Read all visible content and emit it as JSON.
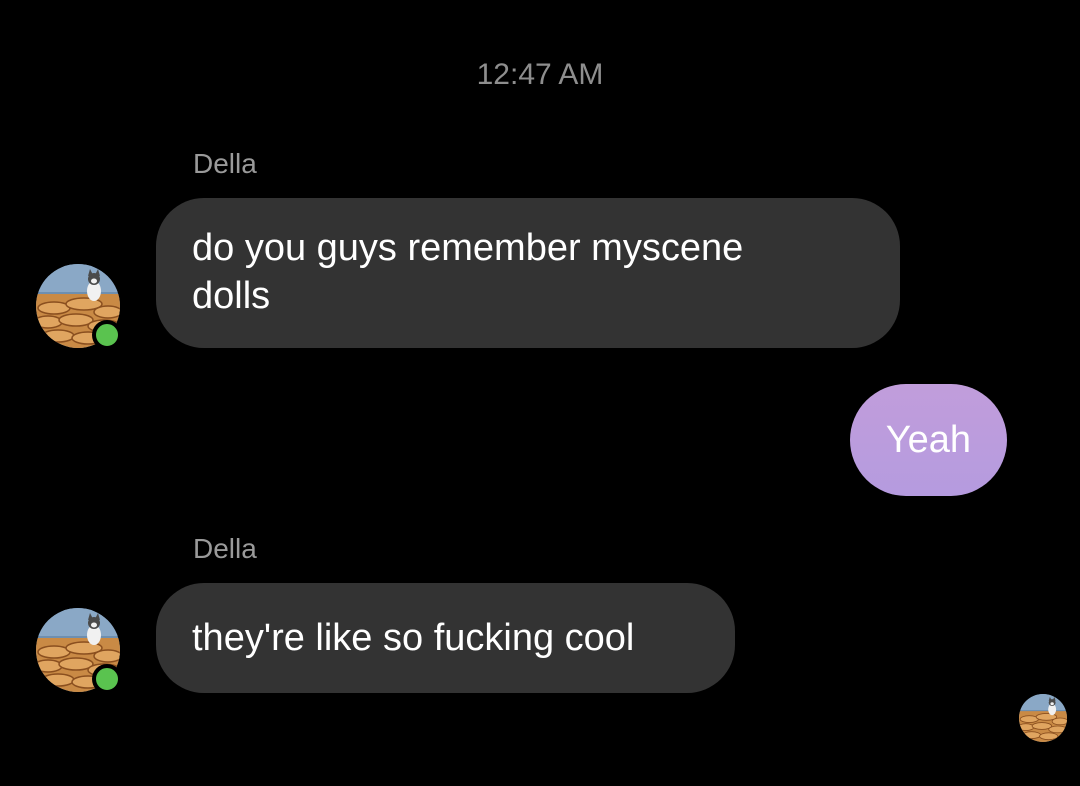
{
  "chat": {
    "timestamp": "12:47 AM",
    "messages": [
      {
        "sender": "Della",
        "direction": "incoming",
        "lines": [
          "do you guys remember myscene",
          "dolls"
        ]
      },
      {
        "direction": "outgoing",
        "text": "Yeah"
      },
      {
        "sender": "Della",
        "direction": "incoming",
        "text": "they're like so fucking cool"
      }
    ],
    "presence": "online",
    "seen_indicator": "avatar"
  },
  "colors": {
    "background": "#000000",
    "incoming_bubble": "#333333",
    "outgoing_bubble": "#b99bdd",
    "online_dot": "#5ac34f",
    "timestamp_text": "#8e8e8e",
    "sender_text": "#9a9a9a"
  }
}
